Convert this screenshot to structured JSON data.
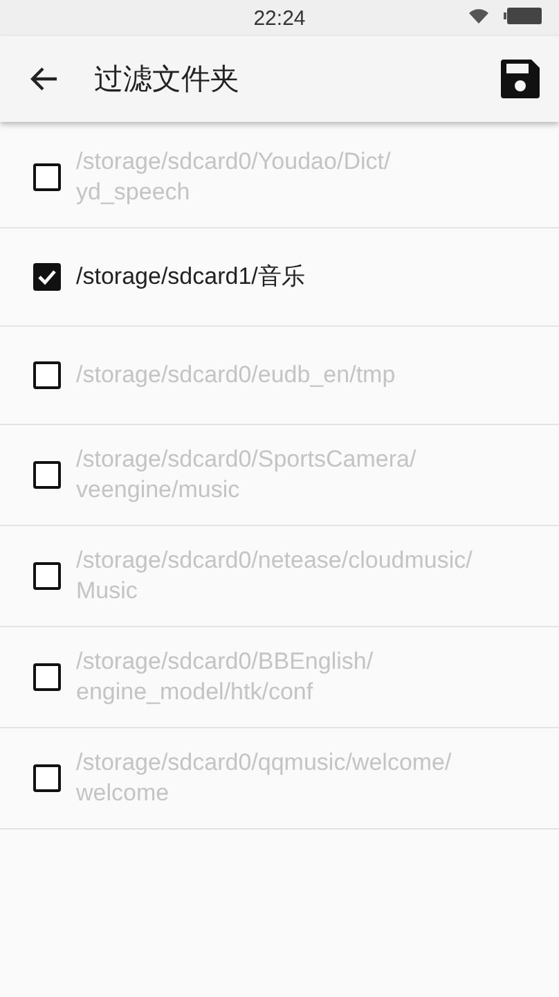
{
  "status_bar": {
    "time": "22:24"
  },
  "app_bar": {
    "title": "过滤文件夹"
  },
  "folders": [
    {
      "path": "/storage/sdcard0/Youdao/Dict/yd_speech",
      "checked": false
    },
    {
      "path": "/storage/sdcard1/音乐",
      "checked": true
    },
    {
      "path": "/storage/sdcard0/eudb_en/tmp",
      "checked": false
    },
    {
      "path": "/storage/sdcard0/SportsCamera/veengine/music",
      "checked": false
    },
    {
      "path": "/storage/sdcard0/netease/cloudmusic/Music",
      "checked": false
    },
    {
      "path": "/storage/sdcard0/BBEnglish/engine_model/htk/conf",
      "checked": false
    },
    {
      "path": "/storage/sdcard0/qqmusic/welcome/welcome",
      "checked": false
    }
  ]
}
